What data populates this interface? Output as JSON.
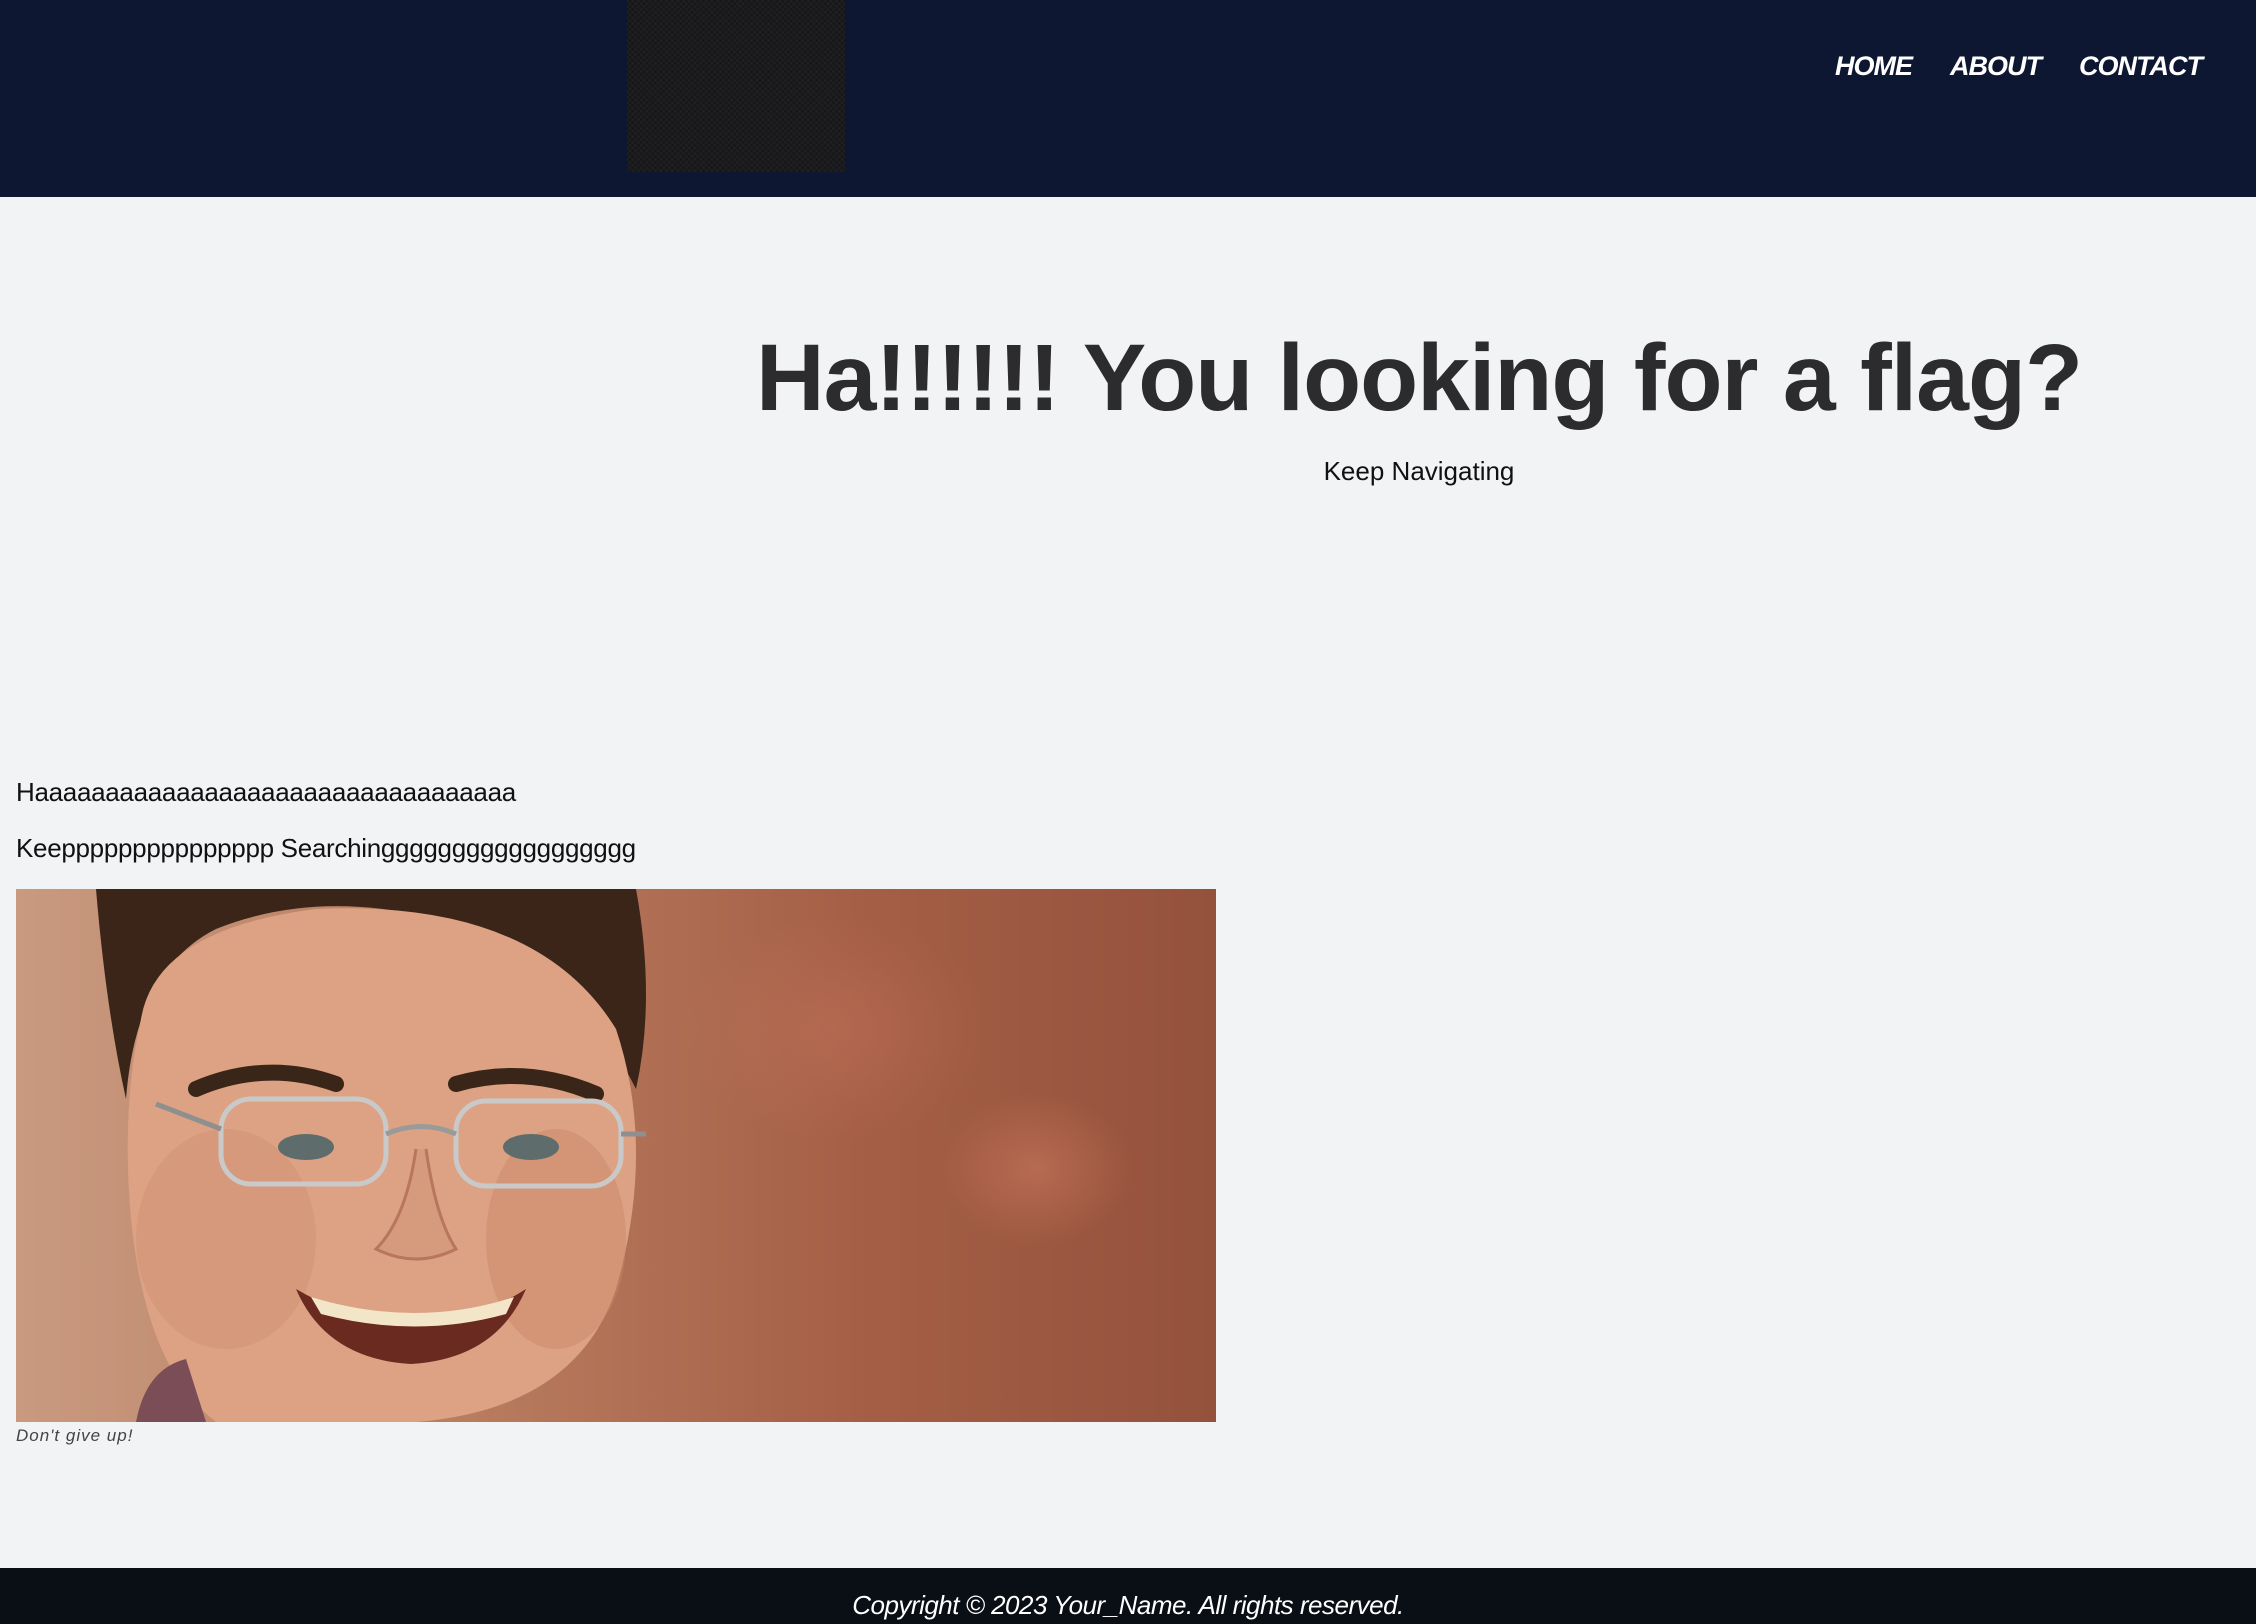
{
  "header": {
    "logo_name": "logo-icon",
    "nav": [
      {
        "label": "HOME"
      },
      {
        "label": "ABOUT"
      },
      {
        "label": "CONTACT"
      }
    ]
  },
  "hero": {
    "title": "Ha!!!!!! You looking for a flag?",
    "subtitle": "Keep Navigating"
  },
  "content": {
    "line1": "Haaaaaaaaaaaaaaaaaaaaaaaaaaaaaaaaaa",
    "line2": "Keeppppppppppppppp Searchingggggggggggggggggg",
    "figure": {
      "caption": "Don't give up!"
    }
  },
  "footer": {
    "copyright": "Copyright © 2023 Your_Name. All rights reserved."
  },
  "colors": {
    "header_bg": "#0e1732",
    "page_bg": "#f2f3f5",
    "footer_bg": "#0a0e15",
    "title": "#2c2c2e"
  }
}
